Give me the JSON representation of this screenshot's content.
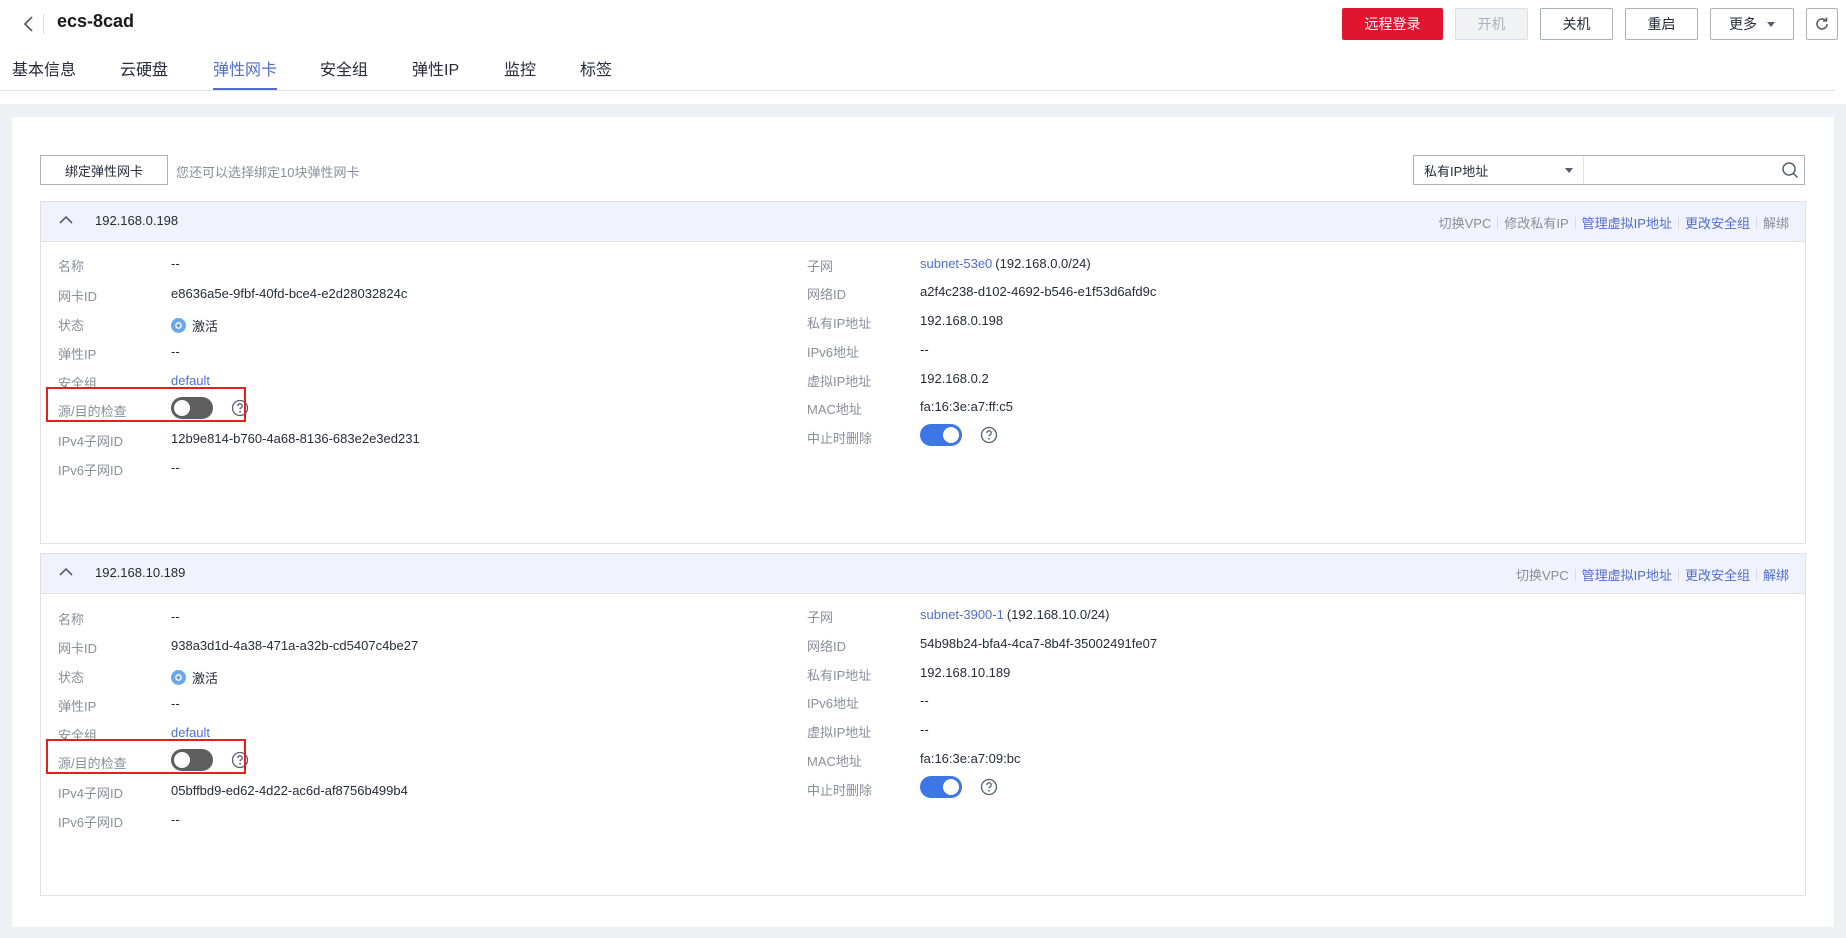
{
  "header": {
    "title": "ecs-8cad",
    "actions": {
      "remote_login": "远程登录",
      "power_on": "开机",
      "power_off": "关机",
      "restart": "重启",
      "more": "更多"
    }
  },
  "tabs": [
    "基本信息",
    "云硬盘",
    "弹性网卡",
    "安全组",
    "弹性IP",
    "监控",
    "标签"
  ],
  "active_tab": "弹性网卡",
  "toolbar": {
    "bind_button": "绑定弹性网卡",
    "hint": "您还可以选择绑定10块弹性网卡",
    "search_select": "私有IP地址",
    "search_value": ""
  },
  "labels": {
    "name": "名称",
    "nic_id": "网卡ID",
    "status": "状态",
    "eip": "弹性IP",
    "security_group": "安全组",
    "src_dst_check": "源/目的检查",
    "ipv4_subnet_id": "IPv4子网ID",
    "ipv6_subnet_id": "IPv6子网ID",
    "subnet": "子网",
    "network_id": "网络ID",
    "private_ip": "私有IP地址",
    "ipv6": "IPv6地址",
    "virtual_ip": "虚拟IP地址",
    "mac": "MAC地址",
    "delete_on_terminate": "中止时删除"
  },
  "nics": [
    {
      "ip": "192.168.0.198",
      "ops": {
        "switch_vpc": "切换VPC",
        "modify_private_ip": "修改私有IP",
        "manage_virtual_ip": "管理虚拟IP地址",
        "change_sg": "更改安全组",
        "unbind": "解绑"
      },
      "name": "--",
      "nic_id": "e8636a5e-9fbf-40fd-bce4-e2d28032824c",
      "status": "激活",
      "eip": "--",
      "security_group": "default",
      "src_dst_check": false,
      "ipv4_subnet_id": "12b9e814-b760-4a68-8136-683e2e3ed231",
      "ipv6_subnet_id": "--",
      "subnet_name": "subnet-53e0",
      "subnet_cidr": "(192.168.0.0/24)",
      "network_id": "a2f4c238-d102-4692-b546-e1f53d6afd9c",
      "private_ip": "192.168.0.198",
      "ipv6": "--",
      "virtual_ip": "192.168.0.2",
      "mac": "fa:16:3e:a7:ff:c5",
      "delete_on_terminate": true
    },
    {
      "ip": "192.168.10.189",
      "ops": {
        "switch_vpc": "切换VPC",
        "manage_virtual_ip": "管理虚拟IP地址",
        "change_sg": "更改安全组",
        "unbind": "解绑"
      },
      "name": "--",
      "nic_id": "938a3d1d-4a38-471a-a32b-cd5407c4be27",
      "status": "激活",
      "eip": "--",
      "security_group": "default",
      "src_dst_check": false,
      "ipv4_subnet_id": "05bffbd9-ed62-4d22-ac6d-af8756b499b4",
      "ipv6_subnet_id": "--",
      "subnet_name": "subnet-3900-1",
      "subnet_cidr": "(192.168.10.0/24)",
      "network_id": "54b98b24-bfa4-4ca7-8b4f-35002491fe07",
      "private_ip": "192.168.10.189",
      "ipv6": "--",
      "virtual_ip": "--",
      "mac": "fa:16:3e:a7:09:bc",
      "delete_on_terminate": true
    }
  ],
  "colors": {
    "primary_red": "#e1152f",
    "link_blue": "#526ecc",
    "toggle_on": "#3e77e5",
    "toggle_off": "#5e5e5e",
    "highlight_box": "#e3201f"
  }
}
